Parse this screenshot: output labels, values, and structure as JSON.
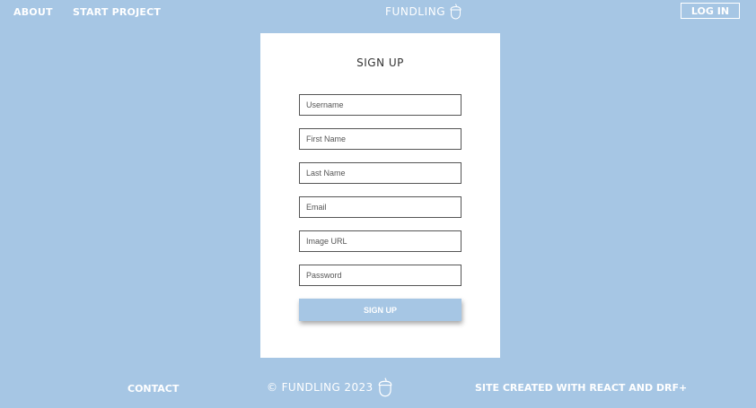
{
  "nav": {
    "about": "ABOUT",
    "start_project": "START PROJECT",
    "brand": "FUNDLING",
    "brand_icon": "acorn-icon",
    "login": "LOG IN"
  },
  "form": {
    "title": "SIGN UP",
    "fields": [
      {
        "placeholder": "Username"
      },
      {
        "placeholder": "First Name"
      },
      {
        "placeholder": "Last Name"
      },
      {
        "placeholder": "Email"
      },
      {
        "placeholder": "Image URL"
      },
      {
        "placeholder": "Password"
      }
    ],
    "submit": "SIGN UP"
  },
  "footer": {
    "contact": "CONTACT",
    "copyright": "© FUNDLING 2023",
    "credit": "SITE CREATED WITH REACT AND DRF+"
  },
  "colors": {
    "background": "#a6c6e4",
    "card": "#ffffff",
    "text_light": "#ffffff",
    "text_dark": "#333333"
  }
}
